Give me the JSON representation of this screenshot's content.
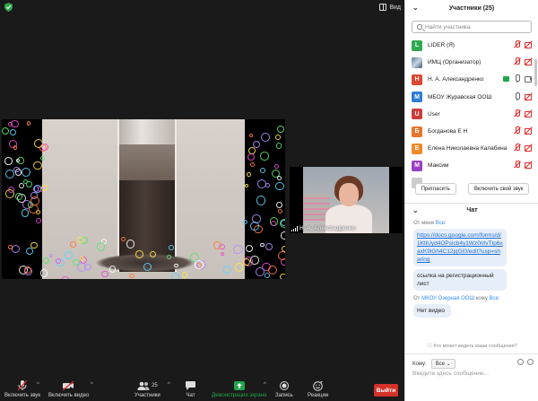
{
  "topbar": {
    "view_label": "Вид"
  },
  "colors": {
    "accent": "#2d8cff",
    "leave": "#d53129",
    "muted_red": "#e02828",
    "share_green": "#21a64a"
  },
  "thumbnail": {
    "name": "Н. А. Александренко"
  },
  "toolbar": {
    "unmute": "Включить звук",
    "start_video": "Включить видео",
    "participants": "Участники",
    "participants_count": "25",
    "chat": "Чат",
    "share_screen": "Демонстрация экрана",
    "record": "Запись",
    "reactions": "Реакции",
    "leave": "Выйти"
  },
  "panel": {
    "title": "Участники (25)",
    "search_placeholder": "Найти участника",
    "participants": [
      {
        "initial": "L",
        "color": "#2fa84f",
        "name": "LIDER (Я)",
        "mic": "off",
        "cam": "off",
        "image": false,
        "share": false
      },
      {
        "initial": "",
        "color": "",
        "name": "ИМЦ (Организатор)",
        "mic": "off",
        "cam": "off",
        "image": true,
        "share": false
      },
      {
        "initial": "Н",
        "color": "#e0452e",
        "name": "Н. А. Александренко",
        "mic": "on",
        "cam": "on",
        "image": false,
        "share": true
      },
      {
        "initial": "М",
        "color": "#2f7dd6",
        "name": "МБОУ Журавская ООШ",
        "mic": "on",
        "cam": "off",
        "image": false,
        "share": false
      },
      {
        "initial": "U",
        "color": "#d13a3a",
        "name": "User",
        "mic": "off",
        "cam": "off",
        "image": false,
        "share": false
      },
      {
        "initial": "Б",
        "color": "#e8742b",
        "name": "Богданова Е Н",
        "mic": "off",
        "cam": "off",
        "image": false,
        "share": false
      },
      {
        "initial": "Е",
        "color": "#f08a2a",
        "name": "Елена Николаевна Калабина",
        "mic": "off",
        "cam": "off",
        "image": false,
        "share": false
      },
      {
        "initial": "М",
        "color": "#9c3fc4",
        "name": "Максим",
        "mic": "off",
        "cam": "off",
        "image": false,
        "share": false
      },
      {
        "initial": "",
        "color": "#cccccc",
        "name": "",
        "mic": "",
        "cam": "",
        "image": false,
        "share": false
      }
    ],
    "invite_label": "Пригласить",
    "unmute_label": "Включить свой звук"
  },
  "chat": {
    "title": "Чат",
    "messages": [
      {
        "from": "От меня",
        "to": "Все",
        "texts": [
          {
            "type": "link",
            "value": "https://docs.google.com/forms/d/1KtlUyd4OPsicb4y1Wz0ntvTIp6xaxK9iGh4C12jqGI0/edit?usp=sharing"
          },
          {
            "type": "text",
            "value": "ссылка на регистрационный лист"
          }
        ]
      },
      {
        "from": "От",
        "sender": "МКОУ Озерная ООШ",
        "to_word": "кому",
        "to": "Все",
        "texts": [
          {
            "type": "text",
            "value": "Нет видео"
          }
        ]
      }
    ],
    "who_can_see": "Кто может видеть ваши сообщения?",
    "to_label": "Кому:",
    "to_value": "Все",
    "input_placeholder": "Введите здесь сообщение..."
  }
}
